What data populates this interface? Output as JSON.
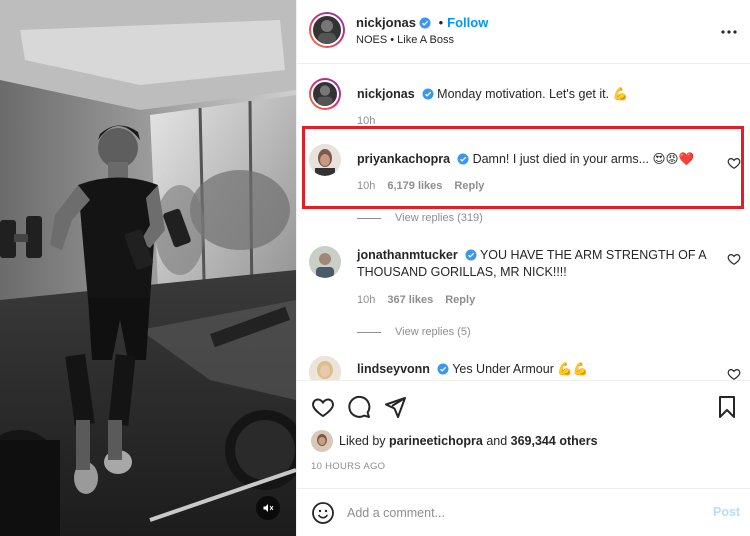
{
  "post_header": {
    "username": "nickjonas",
    "follow_label": "Follow",
    "dot": "•",
    "subtitle": "NOES • Like A Boss"
  },
  "comments": [
    {
      "username": "nickjonas",
      "text": "Monday motivation. Let's get it.",
      "emoji": "💪",
      "time": "10h",
      "avatar": "nickjonas-avatar"
    },
    {
      "username": "priyankachopra",
      "text": "Damn! I just died in your arms...",
      "emoji": "😍😡❤️",
      "time": "10h",
      "likes": "6,179 likes",
      "reply": "Reply",
      "view_replies": "View replies (319)",
      "highlighted": true
    },
    {
      "username": "jonathanmtucker",
      "text_line1": "YOU HAVE THE ARM STRENGTH OF A",
      "text_line2": "THOUSAND GORILLAS, MR NICK!!!!",
      "time": "10h",
      "likes": "367 likes",
      "reply": "Reply",
      "view_replies": "View replies (5)"
    },
    {
      "username": "lindseyvonn",
      "text": "Yes Under Armour",
      "emoji": "💪💪"
    }
  ],
  "likes_bar": {
    "prefix": "Liked by",
    "user": "parineetichopra",
    "middle": "and",
    "count": "369,344 others"
  },
  "timestamp": "10 HOURS AGO",
  "add_comment": {
    "placeholder": "Add a comment...",
    "post_label": "Post"
  },
  "colors": {
    "accent": "#0095f6",
    "highlight_border": "#e31e24",
    "verified": "#3897f0",
    "muted": "#8e8e8e"
  },
  "icons": [
    "verified-badge-icon",
    "more-options-icon",
    "heart-icon",
    "comment-icon",
    "share-icon",
    "bookmark-icon",
    "emoji-icon",
    "mute-icon"
  ]
}
